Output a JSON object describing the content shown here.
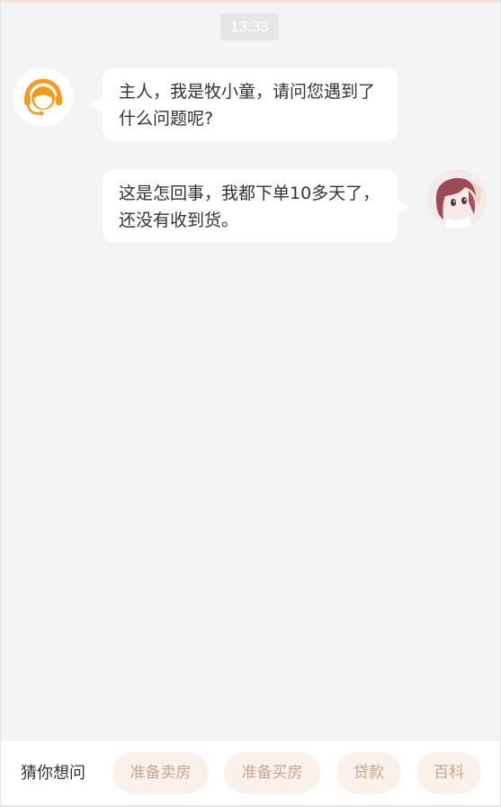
{
  "chat": {
    "timestamp": "13:33",
    "messages": [
      {
        "sender": "bot",
        "avatar_icon": "headset-agent-icon",
        "text": "主人，我是牧小童，请问您遇到了什么问题呢?"
      },
      {
        "sender": "user",
        "avatar_icon": "user-anime-avatar",
        "text": "这是怎回事，我都下单10多天了，还没有收到货。"
      }
    ]
  },
  "suggestions": {
    "label": "猜你想问",
    "chips": [
      "准备卖房",
      "准备买房",
      "贷款",
      "百科"
    ]
  },
  "colors": {
    "background": "#f5f4f4",
    "bubble": "#ffffff",
    "accent_orange": "#f39a1f",
    "chip_bg": "#fbf1eb",
    "chip_text": "#c8a58e"
  }
}
